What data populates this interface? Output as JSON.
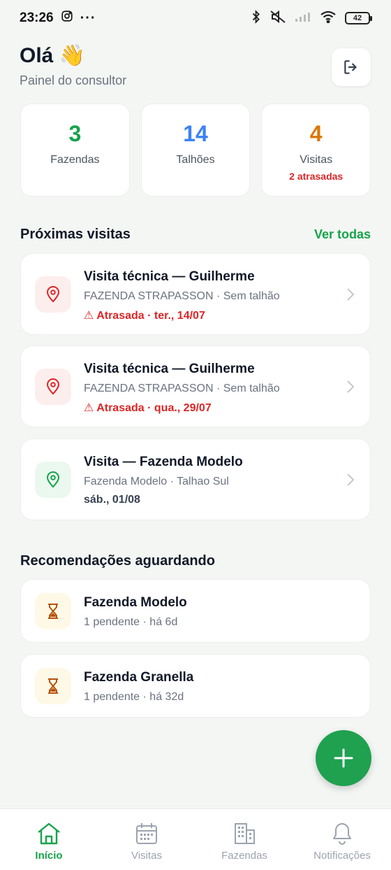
{
  "status_bar": {
    "time": "23:26",
    "battery": "42"
  },
  "header": {
    "greeting": "Olá 👋",
    "subtitle": "Painel do consultor"
  },
  "stats": [
    {
      "value": "3",
      "label": "Fazendas",
      "extra": "",
      "color": "#16a34a"
    },
    {
      "value": "14",
      "label": "Talhões",
      "extra": "",
      "color": "#3b82f6"
    },
    {
      "value": "4",
      "label": "Visitas",
      "extra": "2 atrasadas",
      "color": "#d97706"
    }
  ],
  "visits_section": {
    "title": "Próximas visitas",
    "link": "Ver todas",
    "items": [
      {
        "title": "Visita técnica — Guilherme",
        "subtitle": "FAZENDA STRAPASSON · Sem talhão",
        "date": "⚠ Atrasada · ter., 14/07",
        "overdue": true
      },
      {
        "title": "Visita técnica — Guilherme",
        "subtitle": "FAZENDA STRAPASSON · Sem talhão",
        "date": "⚠ Atrasada · qua., 29/07",
        "overdue": true
      },
      {
        "title": "Visita — Fazenda Modelo",
        "subtitle": "Fazenda Modelo · Talhao Sul",
        "date": "sáb., 01/08",
        "overdue": false
      }
    ]
  },
  "recommendations_section": {
    "title": "Recomendações aguardando",
    "items": [
      {
        "title": "Fazenda Modelo",
        "subtitle": "1 pendente · há 6d"
      },
      {
        "title": "Fazenda Granella",
        "subtitle": "1 pendente · há 32d"
      }
    ]
  },
  "bottom_nav": [
    {
      "label": "Início",
      "icon": "home-icon",
      "active": true
    },
    {
      "label": "Visitas",
      "icon": "calendar-icon",
      "active": false
    },
    {
      "label": "Fazendas",
      "icon": "building-icon",
      "active": false
    },
    {
      "label": "Notificações",
      "icon": "bell-icon",
      "active": false
    }
  ],
  "colors": {
    "accent": "#16a34a",
    "fab": "#1fa150",
    "danger": "#dc2626",
    "pending_bg": "#fef9e7",
    "overdue_bg": "#fdeeee",
    "ok_bg": "#ebf8ef"
  }
}
